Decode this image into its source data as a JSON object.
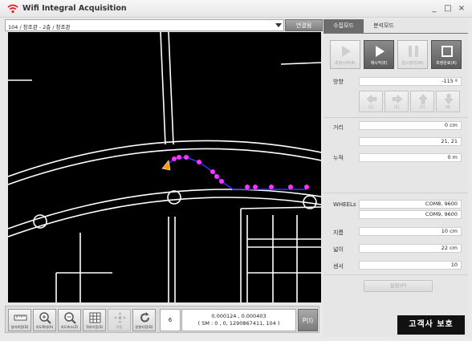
{
  "window": {
    "title": "Wifi Integral Acquisition",
    "controls": {
      "minimize": "_",
      "maximize": "□",
      "close": "×"
    }
  },
  "map_bar": {
    "location": "104 / 창조관 - 2층 / 창조관",
    "connect_label": "연결됨"
  },
  "toolbar": {
    "tools": [
      {
        "icon": "ruler-icon",
        "label": "실미측정(D)",
        "enabled": true
      },
      {
        "icon": "zoom-in-icon",
        "label": "지도확대(A)",
        "enabled": true
      },
      {
        "icon": "zoom-out-icon",
        "label": "지도축소(Z)",
        "enabled": true
      },
      {
        "icon": "grid-icon",
        "label": "격자이동(S)",
        "enabled": true
      },
      {
        "icon": "move-icon",
        "label": "이동",
        "enabled": false
      },
      {
        "icon": "refresh-icon",
        "label": "방향지정(D)",
        "enabled": true
      }
    ],
    "count": "6",
    "coord_line1": "0.000124 , 0.000403",
    "coord_line2": "( SM : 0 , 0, 1290867411, 104 )",
    "p_button": "P(I)"
  },
  "side": {
    "tabs": [
      "수집모드",
      "분석모드"
    ],
    "controls": [
      {
        "icon": "play-icon",
        "label": "측정시작(R)",
        "active": false
      },
      {
        "icon": "play-icon",
        "label": "재시작(E)",
        "active": true
      },
      {
        "icon": "pause-icon",
        "label": "일시정지(W)",
        "active": false
      },
      {
        "icon": "stop-icon",
        "label": "측정완료(R)",
        "active": true
      }
    ],
    "direction_label": "방향",
    "direction_value": "-115 º",
    "arrow_buttons": [
      {
        "icon": "arrow-left-icon",
        "label": "(1)"
      },
      {
        "icon": "arrow-right-icon",
        "label": "(2)"
      },
      {
        "icon": "arrow-up-icon",
        "label": "(3)"
      },
      {
        "icon": "arrow-down-icon",
        "label": "(4)"
      }
    ],
    "distance_label": "거리",
    "distance_value": "0 cm",
    "position_value": "21, 21",
    "cumulative_label": "누적",
    "cumulative_value": "0 m",
    "wheels_label": "WHEELs",
    "wheels_value1": "COM8, 9600",
    "wheels_value2": "COM9, 9600",
    "diameter_label": "지름",
    "diameter_value": "10 cm",
    "width_label": "넓이",
    "width_value": "22 cm",
    "sensor_label": "센서",
    "sensor_value": "10",
    "settings_button": "설정(P)",
    "watermark": "고객사 보호"
  },
  "colors": {
    "app_icon": "#e02020",
    "path_line": "#3333ff",
    "markers": "#ff33ff",
    "map_background": "#000000"
  }
}
